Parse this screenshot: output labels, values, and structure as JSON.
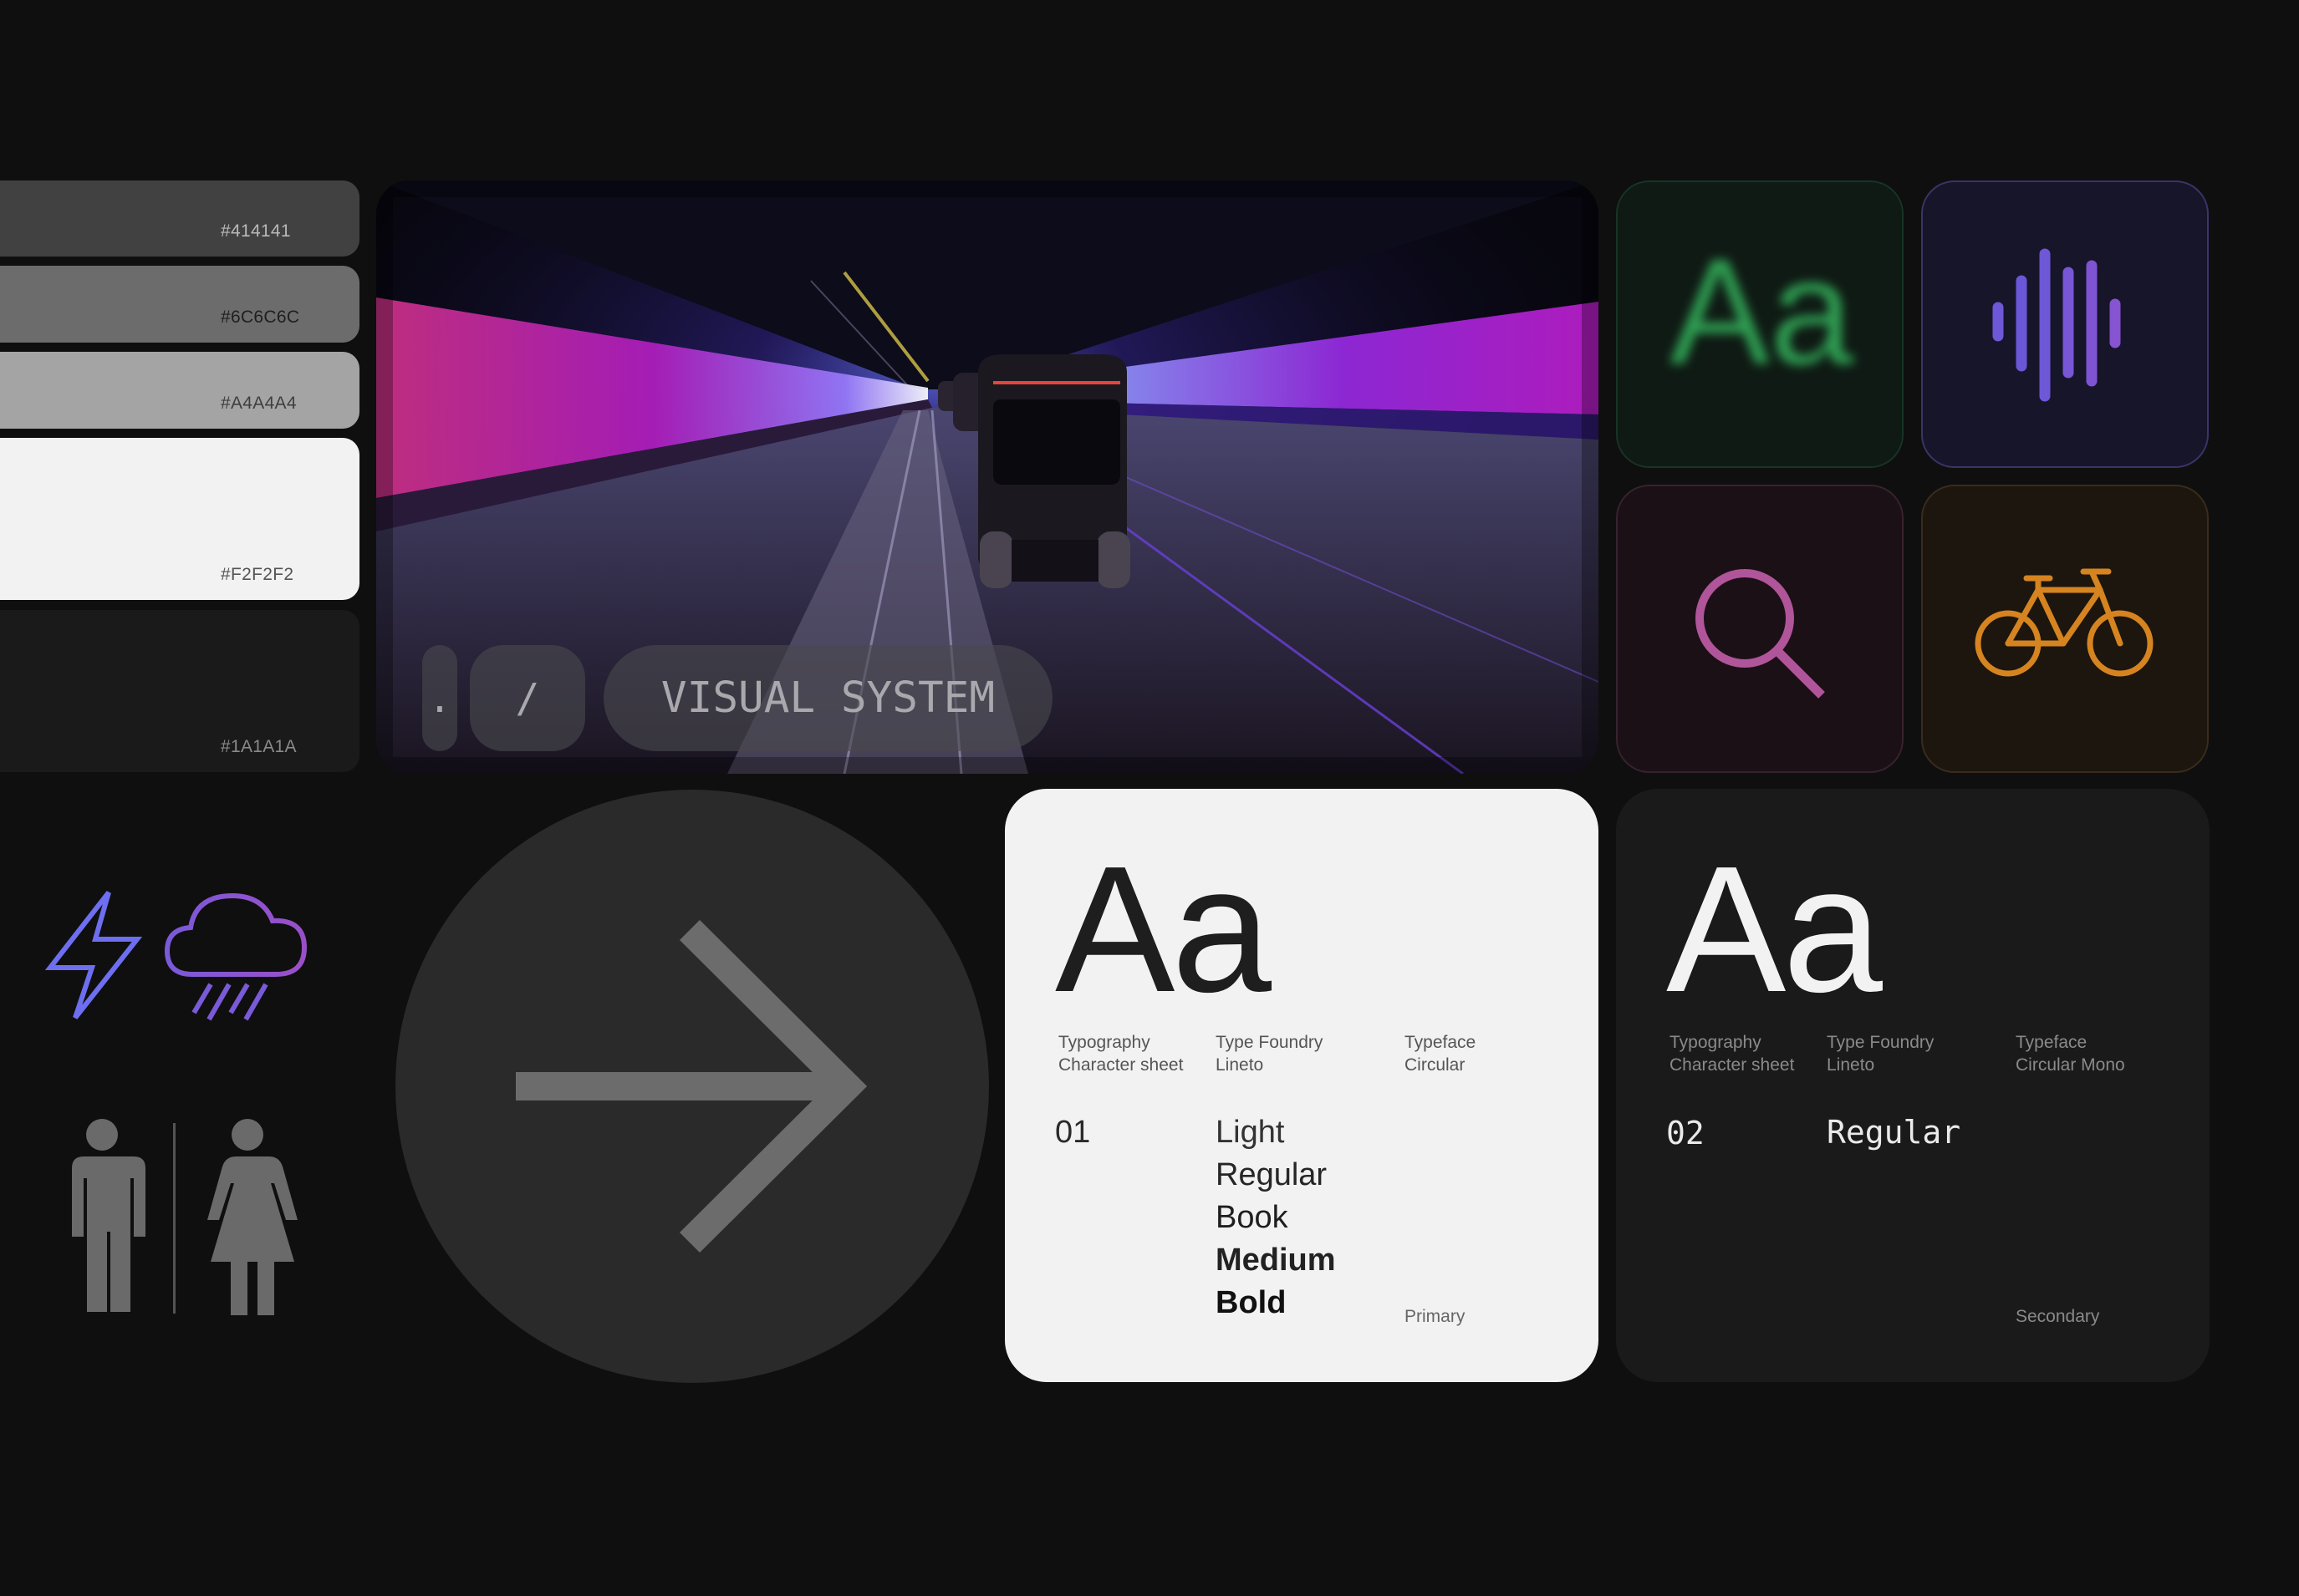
{
  "swatches": [
    {
      "code": "#414141",
      "color": "#414141"
    },
    {
      "code": "#6C6C6C",
      "color": "#6C6C6C"
    },
    {
      "code": "#A4A4A4",
      "color": "#A4A4A4"
    },
    {
      "code": "#F2F2F2",
      "color": "#F2F2F2"
    },
    {
      "code": "#1A1A1A",
      "color": "#1A1A1A"
    }
  ],
  "hero": {
    "dot": ".",
    "slash": "/",
    "label": "VISUAL SYSTEM"
  },
  "tiles": {
    "type": {
      "glyph": "Aa",
      "color": "#3aa35a"
    },
    "sound": {
      "icon": "sound-wave-icon",
      "color": "#7a5ad8"
    },
    "search": {
      "icon": "search-icon",
      "color": "#b0559a"
    },
    "bike": {
      "icon": "bicycle-icon",
      "color": "#d68420"
    }
  },
  "pictograms": [
    "lightning-icon",
    "rain-cloud-icon",
    "man-icon",
    "woman-icon",
    "arrow-right-icon"
  ],
  "type_primary": {
    "sample": "Aa",
    "col1": [
      "Typography",
      "Character sheet"
    ],
    "col2": [
      "Type Foundry",
      "Lineto"
    ],
    "col3": [
      "Typeface",
      "Circular"
    ],
    "number": "01",
    "weights": [
      "Light",
      "Regular",
      "Book",
      "Medium",
      "Bold"
    ],
    "role": "Primary"
  },
  "type_secondary": {
    "sample": "Aa",
    "col1": [
      "Typography",
      "Character sheet"
    ],
    "col2": [
      "Type Foundry",
      "Lineto"
    ],
    "col3": [
      "Typeface",
      "Circular Mono"
    ],
    "number": "02",
    "weights": [
      "Regular"
    ],
    "role": "Secondary"
  }
}
